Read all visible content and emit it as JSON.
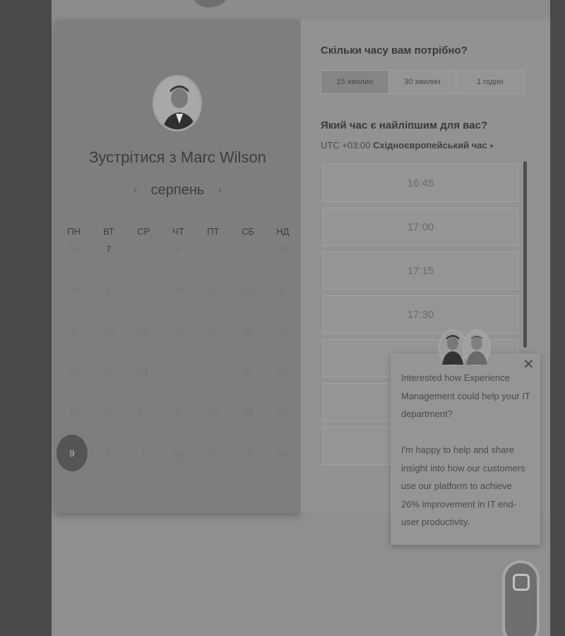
{
  "booking": {
    "meet_title": "Зустрітися з Marc Wilson",
    "month": "серпень",
    "prev_icon": "‹",
    "next_icon": "›",
    "weekdays": [
      "ПН",
      "ВТ",
      "СР",
      "ЧТ",
      "ПТ",
      "СБ",
      "НД"
    ],
    "weeks": [
      [
        "16",
        "7",
        "30",
        "4",
        "2",
        "10",
        "28"
      ],
      [
        "28",
        "4",
        "8",
        "30",
        "30",
        "23",
        "8"
      ],
      [
        "1",
        "03",
        "03",
        "21",
        "29",
        "30",
        "21"
      ],
      [
        "24",
        "17",
        "11",
        "7",
        "7",
        "27",
        "19"
      ],
      [
        "10",
        "18",
        "17",
        "1",
        "28",
        "23",
        "22"
      ],
      [
        "9",
        "9",
        "1",
        "14",
        "30",
        "19",
        "19"
      ]
    ],
    "selected_day": "9"
  },
  "duration": {
    "question": "Скільки часу вам потрібно?",
    "options": [
      "15 хвилин",
      "30 хвилин",
      "1 годин"
    ],
    "selected_index": 0
  },
  "time": {
    "question": "Який час є найліпшим для вас?",
    "tz_prefix": "UTC +03:00",
    "tz_name": "Східноєвропейський час",
    "tz_caret": "▾",
    "slots": [
      "16:45",
      "17:00",
      "17:15",
      "17:30",
      "",
      "",
      ""
    ]
  },
  "chat": {
    "close_icon": "✕",
    "message": "Interested how Experience Management could help your IT department?",
    "message2": "I'm happy to help and share insight into how our customers use our platform to achieve 26% improvement in IT end-user productivity."
  }
}
